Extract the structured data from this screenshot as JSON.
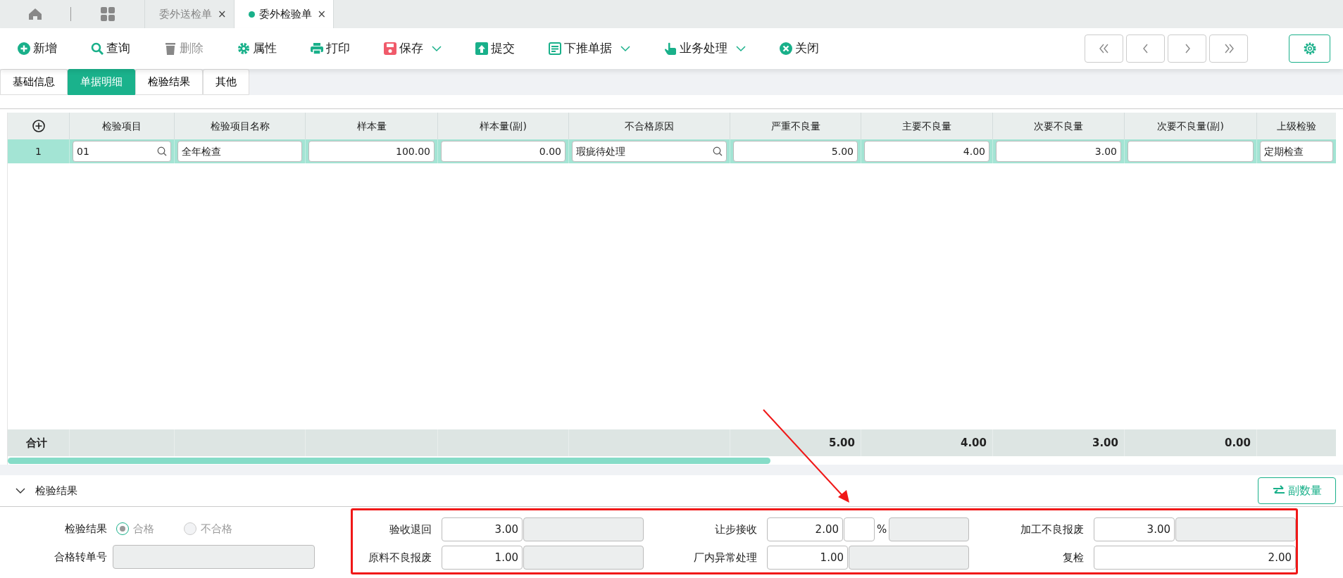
{
  "top_tabs": [
    {
      "label": "委外送检单",
      "selected": false,
      "close": "×"
    },
    {
      "label": "委外检验单",
      "selected": true,
      "close": "×"
    }
  ],
  "toolbar": [
    {
      "label": "新增",
      "disabled": false,
      "has_menu": false
    },
    {
      "label": "查询",
      "disabled": false,
      "has_menu": false
    },
    {
      "label": "删除",
      "disabled": true,
      "has_menu": false
    },
    {
      "label": "属性",
      "disabled": false,
      "has_menu": false
    },
    {
      "label": "打印",
      "disabled": false,
      "has_menu": false
    },
    {
      "label": "保存",
      "disabled": false,
      "has_menu": true
    },
    {
      "label": "提交",
      "disabled": false,
      "has_menu": false
    },
    {
      "label": "下推单据",
      "disabled": false,
      "has_menu": true
    },
    {
      "label": "业务处理",
      "disabled": false,
      "has_menu": true
    },
    {
      "label": "关闭",
      "disabled": false,
      "has_menu": false
    }
  ],
  "sub_tabs": [
    {
      "label": "基础信息",
      "selected": false
    },
    {
      "label": "单据明细",
      "selected": true
    },
    {
      "label": "检验结果",
      "selected": false
    },
    {
      "label": "其他",
      "selected": false
    }
  ],
  "table": {
    "columns": [
      {
        "label": "检验项目"
      },
      {
        "label": "检验项目名称"
      },
      {
        "label": "样本量"
      },
      {
        "label": "样本量(副)"
      },
      {
        "label": "不合格原因"
      },
      {
        "label": "严重不良量",
        "total": "5.00"
      },
      {
        "label": "主要不良量",
        "total": "4.00"
      },
      {
        "label": "次要不良量",
        "total": "3.00"
      },
      {
        "label": "次要不良量(副)",
        "total": "0.00"
      },
      {
        "label": "上级检验"
      }
    ],
    "rows": [
      {
        "index": "1",
        "selected": true,
        "cells": [
          {
            "kind": "lookup",
            "value": "01"
          },
          {
            "kind": "text",
            "value": "全年检查"
          },
          {
            "kind": "number",
            "value": "100.00"
          },
          {
            "kind": "number",
            "value": "0.00"
          },
          {
            "kind": "lookup",
            "value": "瑕疵待处理"
          },
          {
            "kind": "number",
            "value": "5.00"
          },
          {
            "kind": "number",
            "value": "4.00"
          },
          {
            "kind": "number",
            "value": "3.00"
          },
          {
            "kind": "number"
          },
          {
            "kind": "text",
            "value": "定期检查"
          }
        ]
      }
    ],
    "totals_label": "合计"
  },
  "section": {
    "title": "检验结果",
    "expanded": true,
    "button": "副数量"
  },
  "form": {
    "result_label": "检验结果",
    "result_disabled": true,
    "options": [
      {
        "label": "合格",
        "selected": true
      },
      {
        "label": "不合格",
        "selected": false
      }
    ],
    "transfer_label": "合格转单号",
    "fields": [
      {
        "label": "验收退回",
        "value": "3.00",
        "kind": "pair"
      },
      {
        "label": "让步接收",
        "value": "2.00",
        "kind": "percent",
        "unit": "%"
      },
      {
        "label": "加工不良报废",
        "value": "3.00",
        "kind": "pair"
      },
      {
        "label": "原料不良报废",
        "value": "1.00",
        "kind": "pair"
      },
      {
        "label": "厂内异常处理",
        "value": "1.00",
        "kind": "pair"
      },
      {
        "label": "复检",
        "value": "2.00",
        "kind": "single"
      }
    ]
  }
}
